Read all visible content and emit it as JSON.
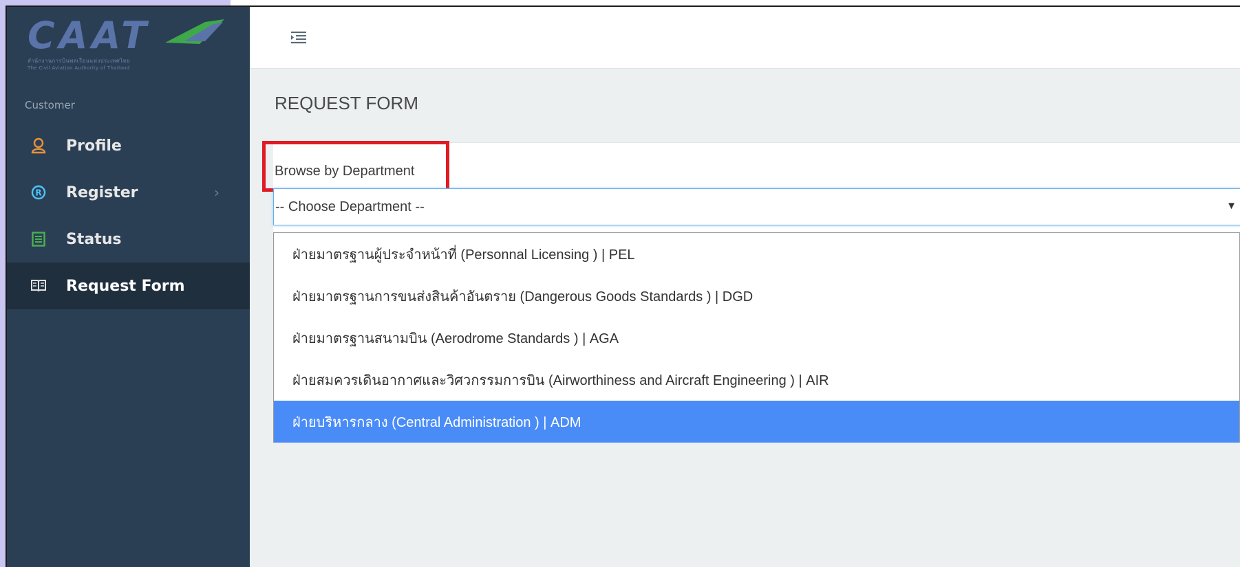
{
  "logo": {
    "wordmark": "CAAT",
    "subtitle_th": "สำนักงานการบินพลเรือนแห่งประเทศไทย",
    "subtitle_en": "The Civil Aviation Authority of Thailand"
  },
  "sidebar": {
    "section_label": "Customer",
    "items": [
      {
        "label": "Profile",
        "icon": "user-icon",
        "color": "#e8923a"
      },
      {
        "label": "Register",
        "icon": "registered-icon",
        "color": "#4fc3f7",
        "has_chevron": true,
        "chevron": "›"
      },
      {
        "label": "Status",
        "icon": "list-icon",
        "color": "#4caf50"
      },
      {
        "label": "Request Form",
        "icon": "book-icon",
        "color": "#e0e0e0",
        "active": true
      }
    ]
  },
  "header": {
    "menu_toggle_icon": "menu-toggle-icon"
  },
  "page": {
    "title": "REQUEST FORM",
    "field_label": "Browse by Department",
    "select_value": "-- Choose Department --",
    "select_arrow": "▼"
  },
  "dropdown": {
    "options": [
      "ฝ่ายมาตรฐานผู้ประจำหน้าที่ (Personnal Licensing ) | PEL",
      "ฝ่ายมาตรฐานการขนส่งสินค้าอันตราย (Dangerous Goods Standards ) | DGD",
      "ฝ่ายมาตรฐานสนามบิน (Aerodrome Standards ) | AGA",
      "ฝ่ายสมควรเดินอากาศและวิศวกรรมการบิน (Airworthiness and Aircraft Engineering ) | AIR",
      "ฝ่ายบริหารกลาง (Central Administration ) | ADM"
    ],
    "highlighted_index": 4
  },
  "colors": {
    "sidebar_bg": "#2a3f54",
    "highlight_border": "#e01b24",
    "selected_option": "#4a8cf7"
  }
}
